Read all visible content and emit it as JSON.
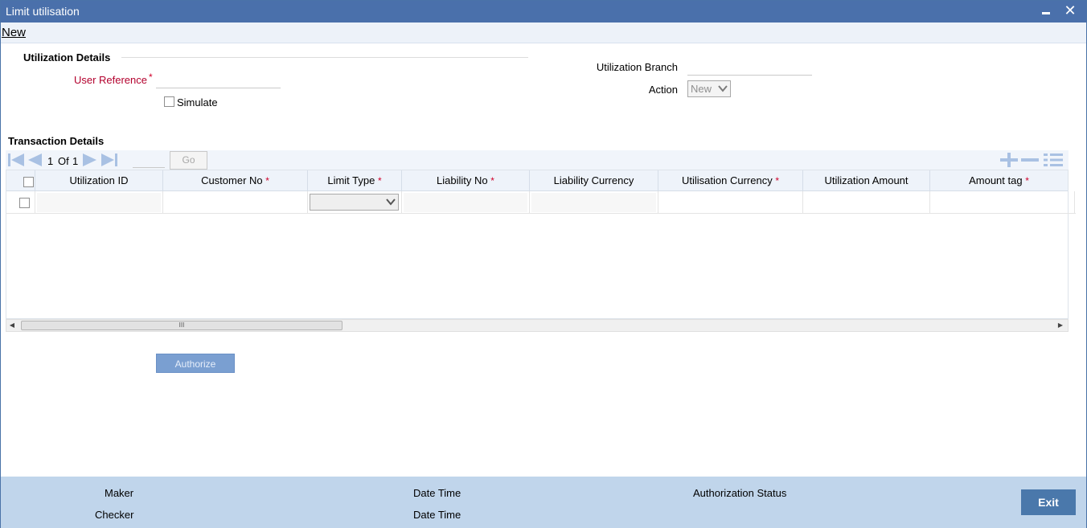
{
  "window": {
    "title": "Limit utilisation",
    "minimize_icon": "minimize-icon",
    "close_icon": "close-icon"
  },
  "toolbar": {
    "new_label": "New"
  },
  "utilization_details": {
    "section_title": "Utilization Details",
    "user_reference_label": "User Reference",
    "user_reference_value": "",
    "required_mark": "*",
    "simulate_label": "Simulate",
    "simulate_checked": false,
    "utilization_branch_label": "Utilization Branch",
    "utilization_branch_value": "",
    "action_label": "Action",
    "action_value": "New"
  },
  "transaction_details": {
    "section_title": "Transaction Details",
    "pager": {
      "current": "1",
      "of_label": "Of",
      "total": "1",
      "go_label": "Go"
    },
    "columns": [
      {
        "label": "Utilization ID",
        "required": false
      },
      {
        "label": "Customer No",
        "required": true
      },
      {
        "label": "Limit Type",
        "required": true
      },
      {
        "label": "Liability No",
        "required": true
      },
      {
        "label": "Liability Currency",
        "required": false
      },
      {
        "label": "Utilisation Currency",
        "required": true
      },
      {
        "label": "Utilization Amount",
        "required": false
      },
      {
        "label": "Amount tag",
        "required": true
      }
    ],
    "rows": [
      {
        "utilization_id": "",
        "customer_no": "",
        "limit_type": "",
        "liability_no": "",
        "liability_currency": "",
        "utilisation_currency": "",
        "utilization_amount": "",
        "amount_tag": ""
      }
    ],
    "scroll_grip": "III"
  },
  "actions": {
    "authorize_label": "Authorize"
  },
  "footer": {
    "maker_label": "Maker",
    "checker_label": "Checker",
    "date_time_label_1": "Date Time",
    "date_time_label_2": "Date Time",
    "authorization_status_label": "Authorization Status",
    "exit_label": "Exit"
  },
  "colors": {
    "titlebar": "#4a70ab",
    "required": "#b3002d",
    "footer": "#c0d5eb",
    "exit_button": "#4a78ab",
    "authorize_button": "#7a9fd1"
  }
}
